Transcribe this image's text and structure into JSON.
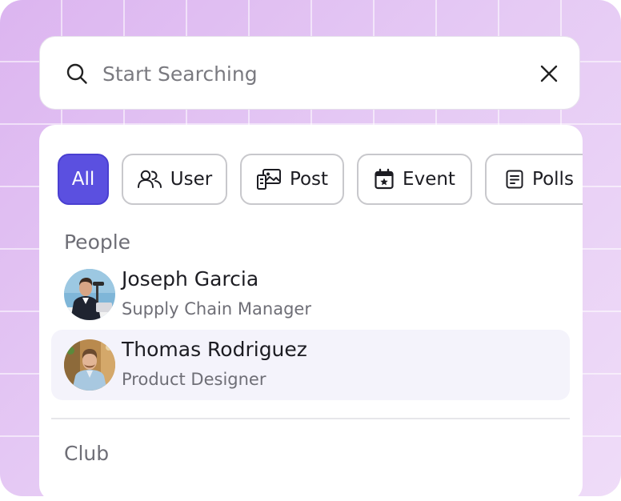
{
  "search": {
    "value": "",
    "placeholder": "Start Searching"
  },
  "filters": [
    {
      "label": "All",
      "icon": "none",
      "active": true
    },
    {
      "label": "User",
      "icon": "users-icon",
      "active": false
    },
    {
      "label": "Post",
      "icon": "images-icon",
      "active": false
    },
    {
      "label": "Event",
      "icon": "calendar-star-icon",
      "active": false
    },
    {
      "label": "Polls",
      "icon": "document-list-icon",
      "active": false
    }
  ],
  "sections": {
    "people_label": "People",
    "club_label": "Club"
  },
  "people": [
    {
      "name": "Joseph Garcia",
      "role": "Supply Chain Manager",
      "highlighted": false
    },
    {
      "name": "Thomas Rodriguez",
      "role": "Product Designer",
      "highlighted": true
    }
  ],
  "colors": {
    "accent": "#5b50e0",
    "background": "#e2c4f2",
    "highlight_row": "#f4f3fb",
    "muted_text": "#6e6e76"
  }
}
